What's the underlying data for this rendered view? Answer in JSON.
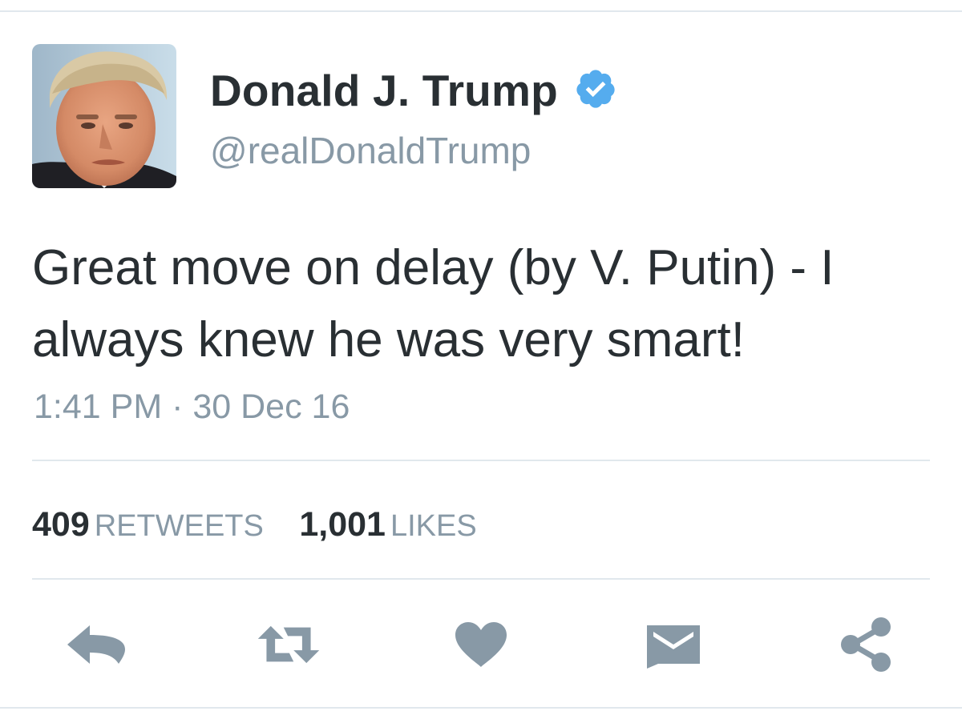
{
  "tweet": {
    "author": {
      "display_name": "Donald J. Trump",
      "handle": "@realDonaldTrump",
      "verified": true,
      "avatar_icon": "profile-photo"
    },
    "text": "Great move on delay (by V. Putin) - I always knew he was very smart!",
    "timestamp": "1:41 PM · 30 Dec 16",
    "stats": {
      "retweets_count": "409",
      "retweets_label": "RETWEETS",
      "likes_count": "1,001",
      "likes_label": "LIKES"
    },
    "actions": [
      {
        "name": "reply",
        "icon": "reply-arrow-icon"
      },
      {
        "name": "retweet",
        "icon": "retweet-icon"
      },
      {
        "name": "like",
        "icon": "heart-icon"
      },
      {
        "name": "message",
        "icon": "envelope-icon"
      },
      {
        "name": "share",
        "icon": "share-icon"
      }
    ]
  },
  "colors": {
    "text_primary": "#292f33",
    "text_secondary": "#8899a6",
    "divider": "#e1e8ed",
    "verified_badge": "#55acee",
    "action_icon": "#8899a6"
  }
}
